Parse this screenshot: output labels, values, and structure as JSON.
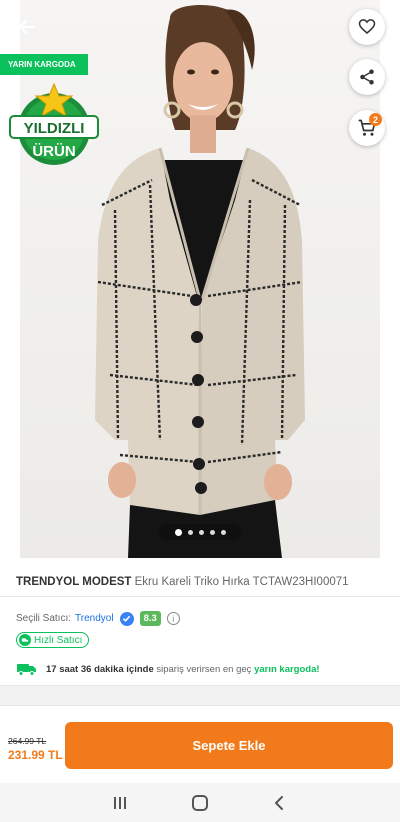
{
  "badges": {
    "delivery_tag": "YARIN KARGODA",
    "star_badge_line1": "YILDIZLI",
    "star_badge_line2": "ÜRÜN",
    "cart_count": "2"
  },
  "carousel": {
    "total": 5,
    "active_index": 0
  },
  "product": {
    "brand": "TRENDYOL MODEST",
    "name": "Ekru Kareli Triko Hırka TCTAW23HI00071"
  },
  "seller": {
    "label": "Seçili Satıcı:",
    "name": "Trendyol",
    "score": "8.3",
    "info_glyph": "i",
    "fast_seller": "Hızlı Satıcı"
  },
  "cargo": {
    "time": "17 saat 36 dakika içinde",
    "middle": "sipariş verirsen en geç",
    "highlight": "yarın kargoda!"
  },
  "pricing": {
    "old_price": "264.99 TL",
    "new_price": "231.99 TL",
    "add_to_cart": "Sepete Ekle"
  },
  "colors": {
    "accent": "#f27a1a",
    "green": "#0bc15c"
  }
}
